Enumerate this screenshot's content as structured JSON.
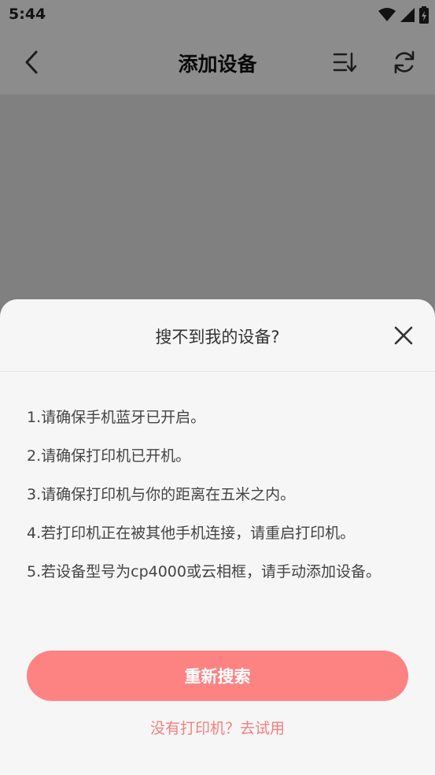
{
  "status_bar": {
    "time": "5:44",
    "icons": [
      "wifi-icon",
      "signal-icon",
      "battery-icon"
    ]
  },
  "app_bar": {
    "title": "添加设备",
    "icons": [
      "back-icon",
      "sort-icon",
      "refresh-icon"
    ]
  },
  "dialog": {
    "title": "搜不到我的设备?",
    "tips": [
      "1.请确保手机蓝牙已开启。",
      "2.请确保打印机已开机。",
      "3.请确保打印机与你的距离在五米之内。",
      "4.若打印机正在被其他手机连接，请重启打印机。",
      "5.若设备型号为cp4000或云相框，请手动添加设备。"
    ],
    "search_again_label": "重新搜索",
    "trial_link": "没有打印机？去试用"
  },
  "colors": {
    "accent": "#fd8383",
    "link": "#f47f7f",
    "sheet_bg": "#f6f6f6"
  }
}
